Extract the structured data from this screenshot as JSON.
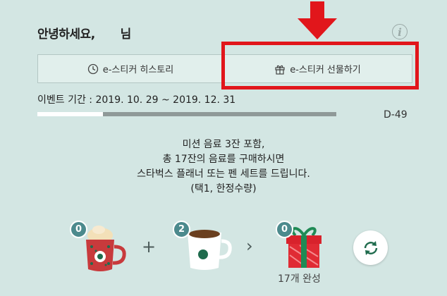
{
  "header": {
    "greeting_prefix": "안녕하세요,",
    "greeting_suffix": "님",
    "info_icon": "i"
  },
  "tabs": [
    {
      "label": "e-스티커 히스토리",
      "icon": "clock-icon"
    },
    {
      "label": "e-스티커 선물하기",
      "icon": "gift-icon"
    }
  ],
  "highlight": {
    "color": "#e1161b"
  },
  "event": {
    "period_text": "이벤트 기간 : 2019. 10. 29 ~ 2019. 12. 31",
    "progress_fraction": 0.22,
    "dday": "D-49"
  },
  "mission": {
    "lines": [
      "미션 음료 3잔 포함,",
      "총 17잔의 음료를 구매하시면",
      "스타벅스 플래너 또는 펜 세트를 드립니다.",
      "(택1, 한정수량)"
    ]
  },
  "stickers": {
    "items": [
      {
        "name": "red-cup-icon",
        "count": "0"
      },
      {
        "name": "white-cup-icon",
        "count": "2"
      },
      {
        "name": "gift-box-icon",
        "count": "0"
      }
    ],
    "plus": "+",
    "arrow": "›",
    "completion": "17개 완성"
  },
  "colors": {
    "background": "#d3e6e3",
    "badge": "#4c8a8d",
    "progress_track": "#8f9998",
    "progress_fill": "#ffffff"
  }
}
